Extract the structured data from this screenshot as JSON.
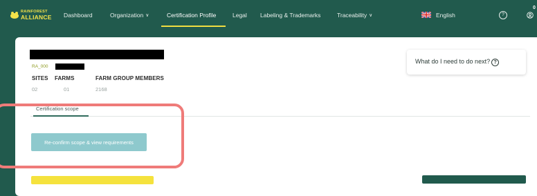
{
  "brand": {
    "line1": "RAINFOREST",
    "line2": "ALLIANCE"
  },
  "nav": {
    "dashboard": "Dashboard",
    "organization": "Organization",
    "certification_profile": "Certification Profile",
    "legal": "Legal",
    "labeling": "Labeling & Trademarks",
    "traceability": "Traceability",
    "language": "English",
    "notification_count": "0"
  },
  "org": {
    "id_prefix": "RA_000"
  },
  "stats": [
    {
      "label": "SITES",
      "value": "02"
    },
    {
      "label": "FARMS",
      "value": "01"
    },
    {
      "label": "FARM GROUP MEMBERS",
      "value": "2168"
    }
  ],
  "help": {
    "next_label": "What do I need to do next?"
  },
  "tabs": [
    {
      "label": "Certification scope"
    }
  ],
  "actions": {
    "reconfirm_label": "Re-confirm scope & view requirements"
  },
  "colors": {
    "nav_bg": "#215a4d",
    "accent_yellow": "#f2de40",
    "button_teal": "#8ec9cd",
    "highlight": "#ef7b79"
  }
}
